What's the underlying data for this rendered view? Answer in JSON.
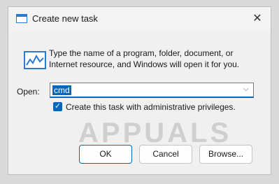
{
  "window": {
    "title": "Create new task",
    "close_glyph": "✕"
  },
  "prompt": {
    "text": "Type the name of a program, folder, document, or Internet resource, and Windows will open it for you."
  },
  "open": {
    "label": "Open:",
    "value": "cmd",
    "dropdown_glyph": "⌵"
  },
  "admin_checkbox": {
    "checked": true,
    "label": "Create this task with administrative privileges."
  },
  "watermark": {
    "text": "APPUALS"
  },
  "buttons": {
    "ok": "OK",
    "cancel": "Cancel",
    "browse": "Browse..."
  },
  "colors": {
    "accent": "#0067c0",
    "dialog_bg": "#f0f0f0",
    "icon_blue": "#2a7ad4"
  },
  "icons": {
    "title": "run-window-icon",
    "program": "task-manager-graph-icon",
    "close": "close-icon",
    "dropdown": "chevron-down-icon",
    "check": "checkmark-icon"
  }
}
